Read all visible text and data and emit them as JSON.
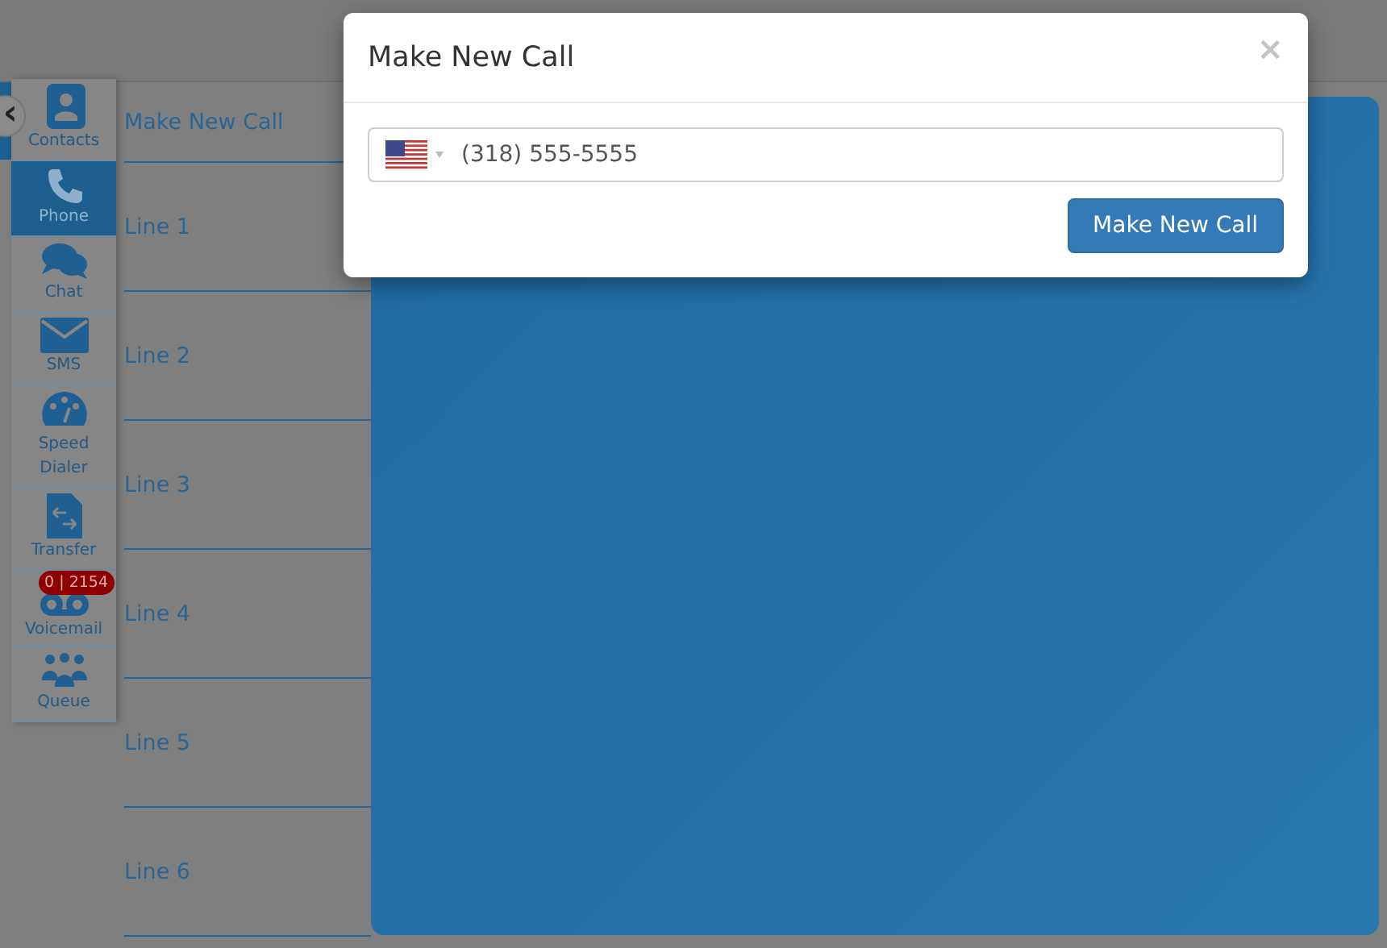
{
  "sidebar": {
    "collapse_icon": "‹",
    "items": [
      {
        "label": "Contacts",
        "kind": "contacts",
        "selected": false
      },
      {
        "label": "Phone",
        "kind": "phone",
        "selected": true
      },
      {
        "label": "Chat",
        "kind": "chat",
        "selected": false
      },
      {
        "label": "SMS",
        "kind": "sms",
        "selected": false
      },
      {
        "label": "Speed Dialer",
        "kind": "speed",
        "selected": false
      },
      {
        "label": "Transfer",
        "kind": "transfer",
        "selected": false
      },
      {
        "label": "Voicemail",
        "kind": "voicemail",
        "selected": false,
        "badge": "0 | 2154"
      },
      {
        "label": "Queue",
        "kind": "queue",
        "selected": false
      }
    ]
  },
  "lines": {
    "header": "Make New Call",
    "items": [
      "Line 1",
      "Line 2",
      "Line 3",
      "Line 4",
      "Line 5",
      "Line 6"
    ]
  },
  "dialog": {
    "title": "Make New Call",
    "close": "×",
    "phone_value": "(318) 555-5555",
    "button": "Make New Call"
  }
}
